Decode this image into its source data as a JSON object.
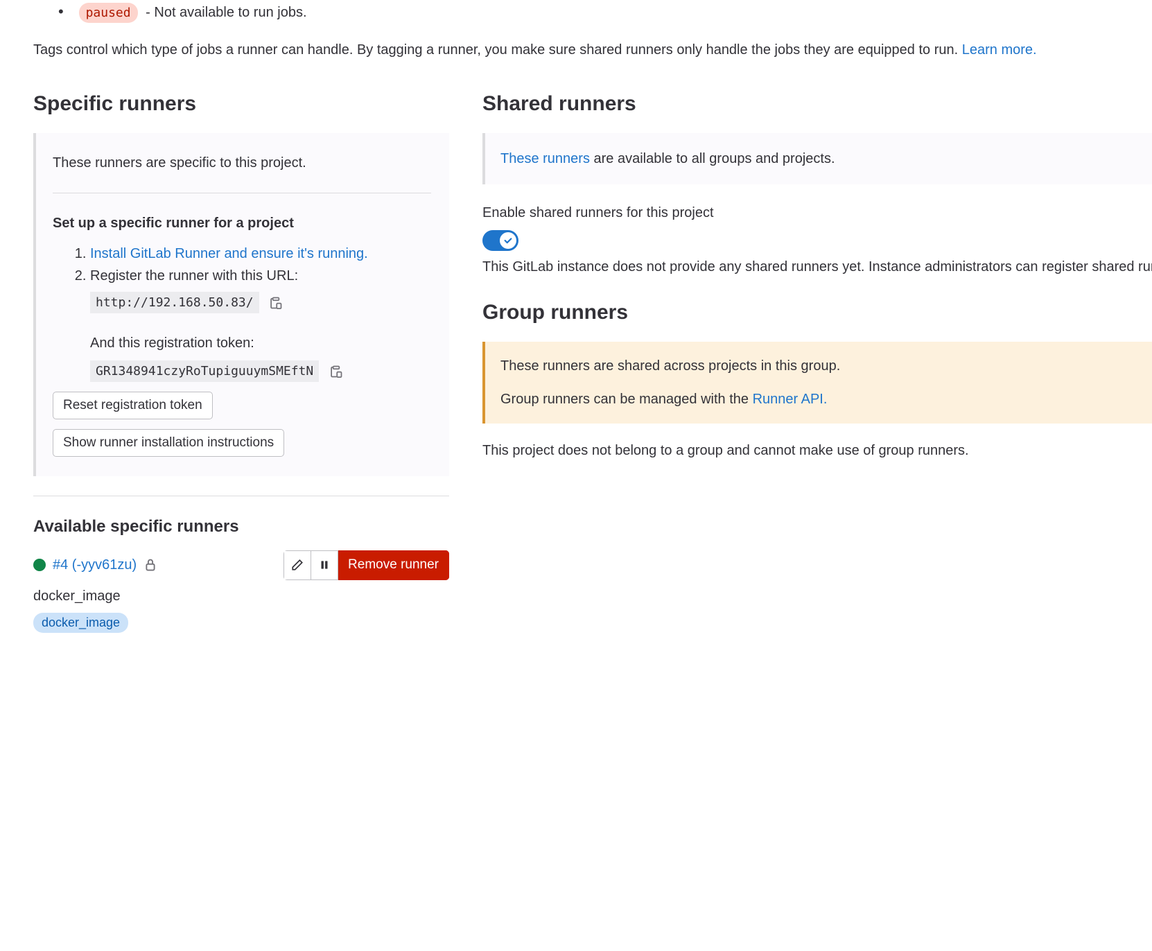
{
  "paused": {
    "badge": "paused",
    "text": "- Not available to run jobs."
  },
  "intro": {
    "text_part1": "Tags control which type of jobs a runner can handle. By tagging a runner, you make sure shared runners only handle the jobs they are equipped to run. ",
    "learn_more": "Learn more."
  },
  "specific": {
    "heading": "Specific runners",
    "well_intro": "These runners are specific to this project.",
    "setup_title": "Set up a specific runner for a project",
    "step1_link": "Install GitLab Runner and ensure it's running.",
    "step2_text": "Register the runner with this URL:",
    "url": "http://192.168.50.83/",
    "token_label": "And this registration token:",
    "token": "GR1348941czyRoTupiguuymSMEftN",
    "reset_btn": "Reset registration token",
    "show_instructions_btn": "Show runner installation instructions"
  },
  "available": {
    "heading": "Available specific runners",
    "runner": {
      "id": "#4 (-yyv61zu)",
      "desc": "docker_image",
      "tag": "docker_image",
      "remove": "Remove runner"
    }
  },
  "shared": {
    "heading": "Shared runners",
    "well_link": "These runners",
    "well_text": " are available to all groups and projects.",
    "toggle_label": "Enable shared runners for this project",
    "desc": "This GitLab instance does not provide any shared runners yet. Instance administrators can register shared runners in the admin area."
  },
  "group": {
    "heading": "Group runners",
    "well_line1": "These runners are shared across projects in this group.",
    "well_line2_text": "Group runners can be managed with the ",
    "well_line2_link": "Runner API.",
    "desc": "This project does not belong to a group and cannot make use of group runners."
  }
}
